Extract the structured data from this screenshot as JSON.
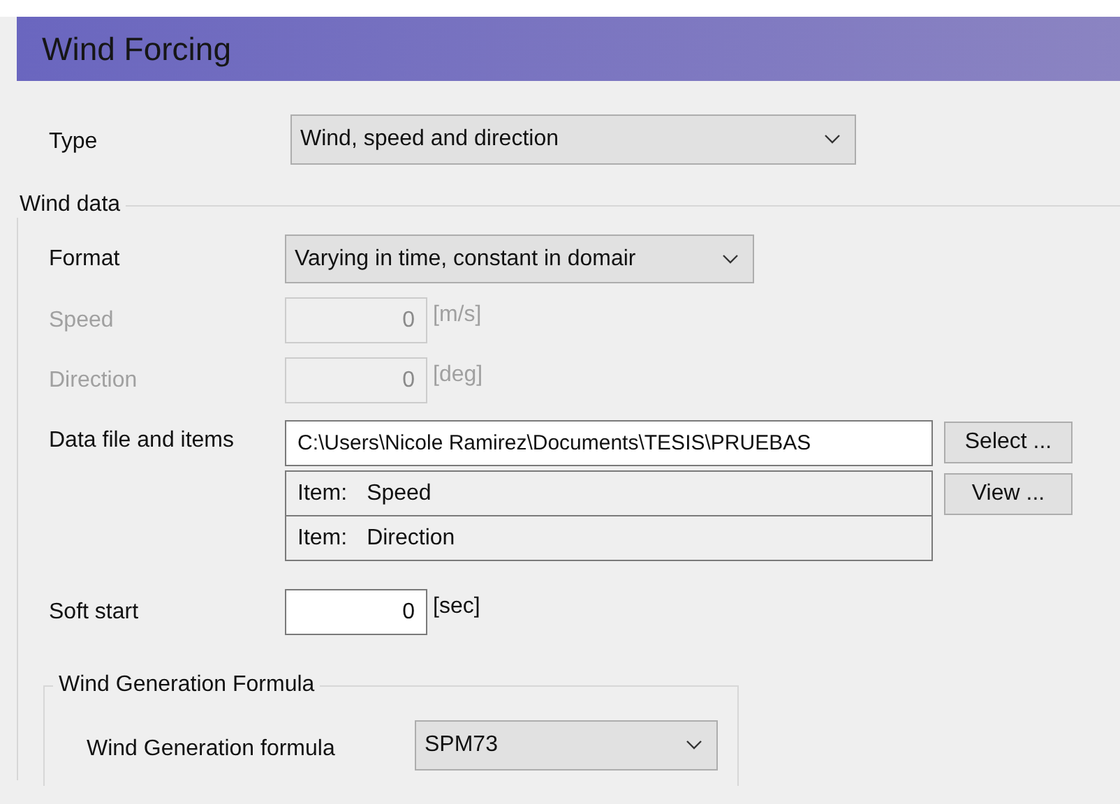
{
  "header": {
    "title": "Wind Forcing"
  },
  "type": {
    "label": "Type",
    "value": "Wind, speed and direction"
  },
  "wind_data": {
    "title": "Wind data",
    "fields": [
      {
        "kind": "dropdown",
        "label": "Format",
        "value": "Varying in time, constant in domair",
        "disabled": false
      },
      {
        "kind": "number",
        "label": "Speed",
        "value": "0",
        "unit": "[m/s]",
        "disabled": true
      },
      {
        "kind": "number",
        "label": "Direction",
        "value": "0",
        "unit": "[deg]",
        "disabled": true
      },
      {
        "kind": "file",
        "label": "Data file and items",
        "value": "C:\\Users\\Nicole Ramirez\\Documents\\TESIS\\PRUEBAS",
        "buttons": [
          "Select ...",
          "View ..."
        ],
        "items": [
          {
            "prefix": "Item:",
            "name": "Speed"
          },
          {
            "prefix": "Item:",
            "name": "Direction"
          }
        ]
      },
      {
        "kind": "number",
        "label": "Soft start",
        "value": "0",
        "unit": "[sec]",
        "disabled": false
      }
    ],
    "formula_group": {
      "title": "Wind Generation Formula",
      "label": "Wind Generation formula",
      "value": "SPM73"
    }
  }
}
